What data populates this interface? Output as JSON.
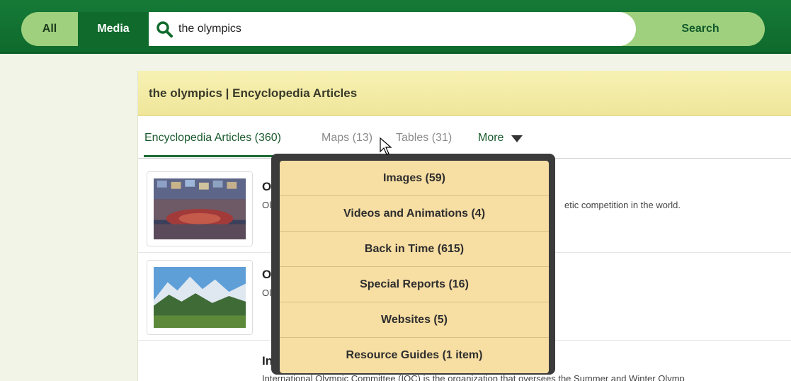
{
  "search": {
    "tab_all": "All",
    "tab_media": "Media",
    "query": "the olympics",
    "button": "Search"
  },
  "panel": {
    "header": "the olympics | Encyclopedia Articles",
    "tabs": {
      "encyclopedia": "Encyclopedia Articles (360)",
      "maps": "Maps (13)",
      "tables": "Tables (31)",
      "more": "More"
    }
  },
  "results": [
    {
      "title": "Ol",
      "text": "Oly",
      "text_tail": "etic competition in the world."
    },
    {
      "title": "Ol",
      "text": "Oly"
    },
    {
      "title": "Int",
      "text": "International Olympic Committee (IOC) is the organization that oversees the Summer and Winter Olymp"
    }
  ],
  "dropdown": [
    "Images (59)",
    "Videos and Animations (4)",
    "Back in Time (615)",
    "Special Reports (16)",
    "Websites (5)",
    "Resource Guides (1 item)"
  ],
  "colors": {
    "brand_green": "#0f6a2b",
    "header_yellow": "#efe69a",
    "menu_bg": "#f7dea3"
  }
}
